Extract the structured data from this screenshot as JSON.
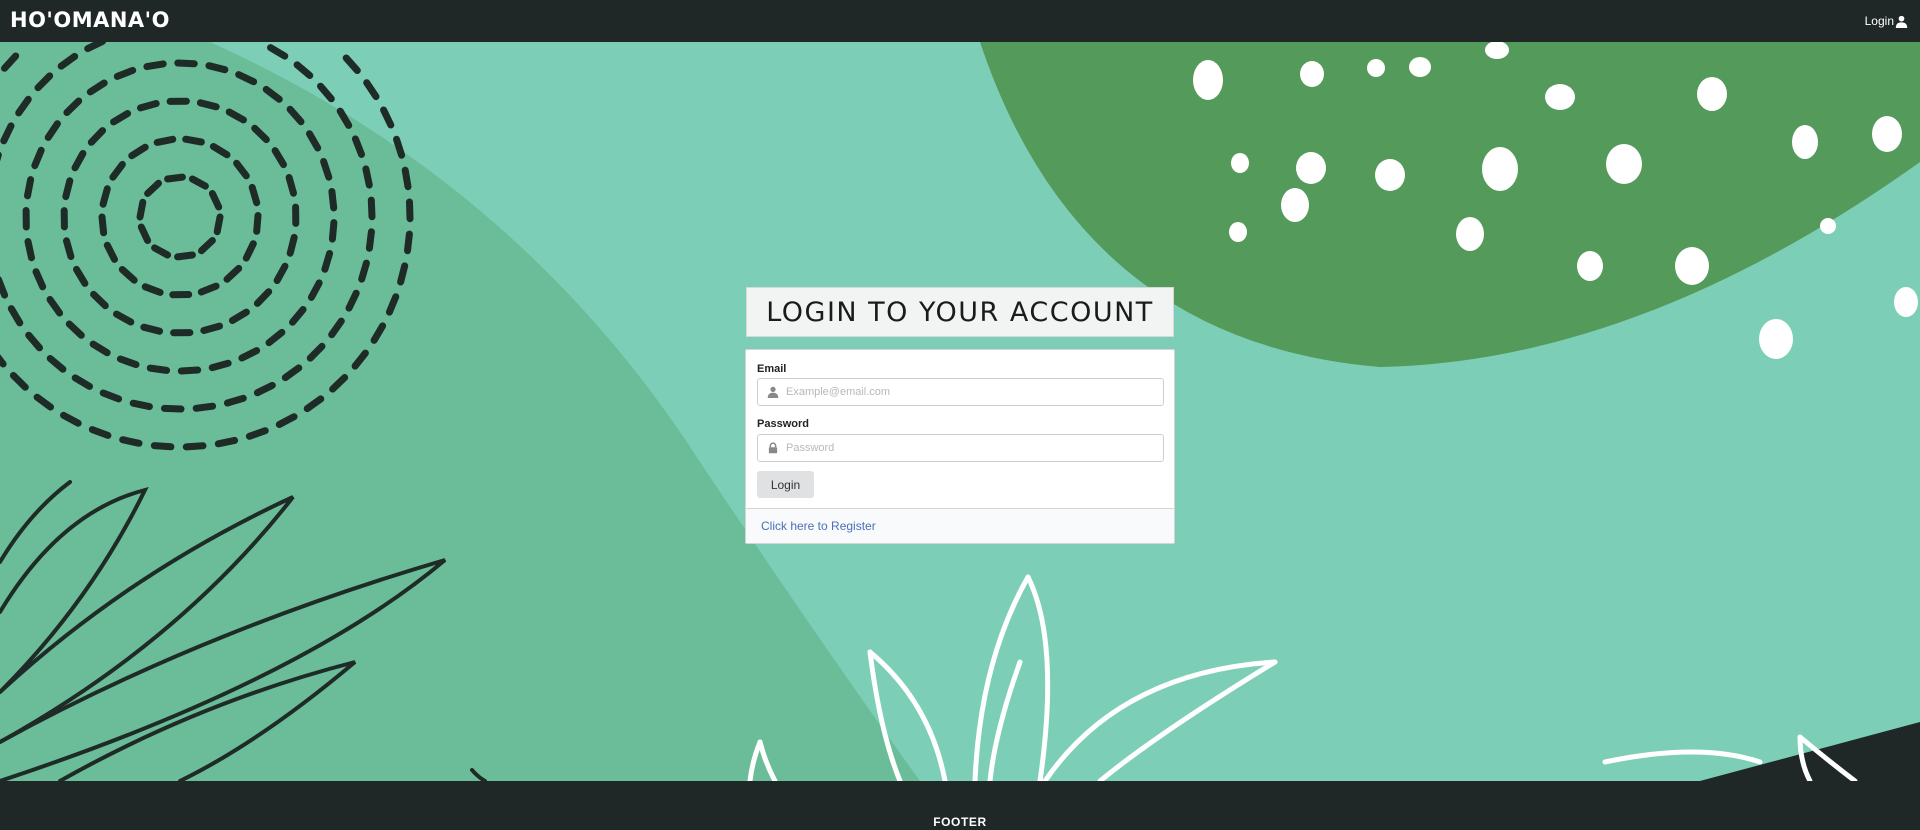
{
  "navbar": {
    "brand": "HO'OMANA'O",
    "login_label": "Login",
    "login_icon": "user-icon"
  },
  "login": {
    "title": "LOGIN TO YOUR ACCOUNT",
    "email_label": "Email",
    "email_placeholder": "Example@email.com",
    "email_value": "",
    "email_icon": "user-icon",
    "password_label": "Password",
    "password_placeholder": "Password",
    "password_value": "",
    "password_icon": "lock-icon",
    "submit_label": "Login",
    "register_link": "Click here to Register"
  },
  "footer": {
    "text": "FOOTER"
  },
  "colors": {
    "navbar_bg": "#1f2727",
    "background_teal": "#7ccfb6",
    "background_green": "#549a5a",
    "background_mid": "#6abd98",
    "link": "#4a6fb5"
  }
}
